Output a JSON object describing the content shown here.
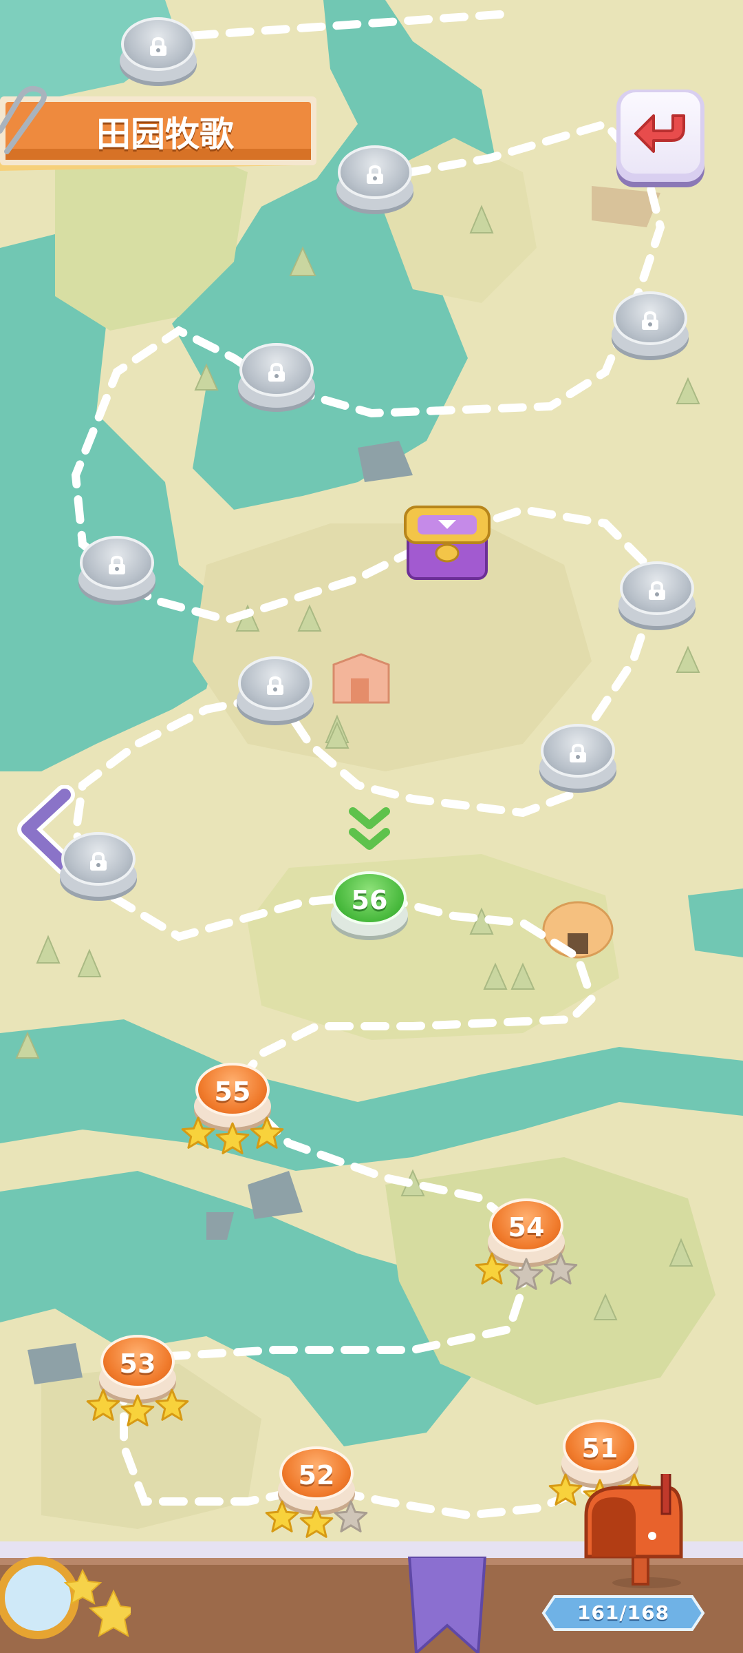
{
  "header": {
    "title": "田园牧歌"
  },
  "levels": {
    "l51": {
      "label": "51",
      "stars": 3
    },
    "l52": {
      "label": "52",
      "stars": 2
    },
    "l53": {
      "label": "53",
      "stars": 3
    },
    "l54": {
      "label": "54",
      "stars": 1
    },
    "l55": {
      "label": "55",
      "stars": 3
    },
    "l56": {
      "label": "56",
      "status": "current"
    }
  },
  "footer": {
    "progress_text": "161/168"
  },
  "colors": {
    "water": "#71c7b3",
    "land": "#e9e4b8",
    "grass": "#d9dfa5",
    "banner": "#ee8a3e",
    "current_level": "#46b83b",
    "completed_level": "#f07a2b",
    "locked_level": "#b9c1ca"
  },
  "icons": {
    "back": "return-arrow-icon",
    "prev": "chevron-left-icon",
    "reward": "treasure-chest-icon",
    "search": "magnifier-icon",
    "mail": "mailbox-icon"
  }
}
